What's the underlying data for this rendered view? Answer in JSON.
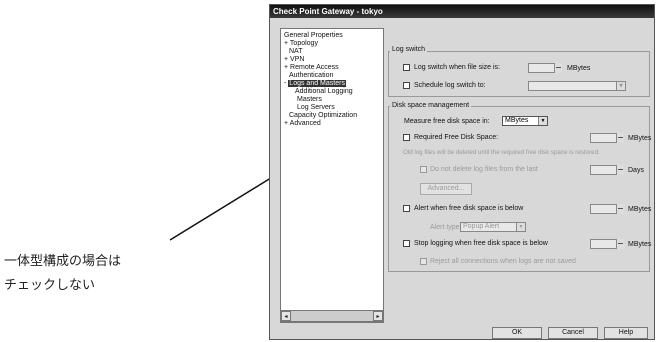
{
  "window": {
    "title": "Check Point Gateway - tokyo"
  },
  "tree": {
    "items": [
      {
        "label": "General Properties",
        "expander": ""
      },
      {
        "label": "Topology",
        "expander": "+"
      },
      {
        "label": "NAT",
        "expander": ""
      },
      {
        "label": "VPN",
        "expander": "+"
      },
      {
        "label": "Remote Access",
        "expander": "+"
      },
      {
        "label": "Authentication",
        "expander": ""
      },
      {
        "label": "Logs and Masters",
        "expander": "-"
      },
      {
        "label": "Additional Logging",
        "expander": ""
      },
      {
        "label": "Masters",
        "expander": ""
      },
      {
        "label": "Log Servers",
        "expander": ""
      },
      {
        "label": "Capacity Optimization",
        "expander": ""
      },
      {
        "label": "Advanced",
        "expander": "+"
      }
    ]
  },
  "panel": {
    "log_switch_group": "Log switch",
    "log_switch_size": "Log switch when file size is:",
    "log_switch_size_unit": "MBytes",
    "schedule_switch": "Schedule log switch to:",
    "disk_space_group": "Disk space management",
    "measure_label": "Measure free disk space in:",
    "measure_value": "MBytes",
    "required_free": "Required Free Disk Space:",
    "required_free_unit": "MBytes",
    "old_files_note": "Old log files will be deleted until the required free disk space is restored.",
    "do_not_delete": "Do not delete log files from the last",
    "do_not_delete_unit": "Days",
    "advanced_button": "Advanced...",
    "alert_free": "Alert when free disk space is below",
    "alert_free_unit": "MBytes",
    "alert_type_label": "Alert type:",
    "alert_type_value": "Popup Alert",
    "stop_logging": "Stop logging when free disk space is below",
    "stop_logging_unit": "MBytes",
    "reject_connections": "Reject all connections when logs are not saved"
  },
  "buttons": {
    "ok": "OK",
    "cancel": "Cancel",
    "help": "Help"
  },
  "caption": {
    "line1": "一体型構成の場合は",
    "line2": "チェックしない"
  }
}
